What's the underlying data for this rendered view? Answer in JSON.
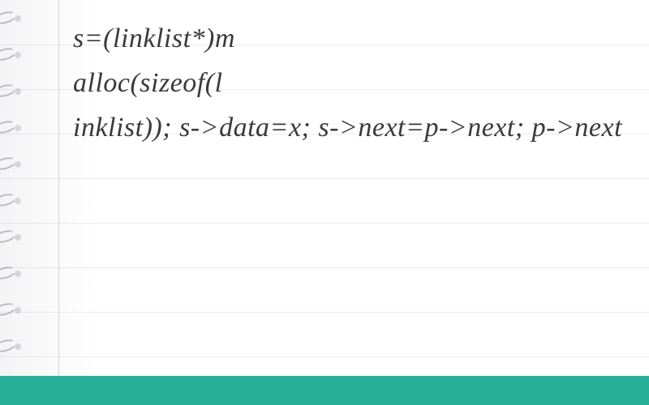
{
  "code": {
    "line1": "s=(linklist*)m",
    "line2": "alloc(sizeof(l",
    "line3": "inklist)); s->data=x; s->next=p->next; p->next"
  },
  "layout": {
    "line_spacing": 55,
    "line_count": 9,
    "spiral_count": 11
  }
}
